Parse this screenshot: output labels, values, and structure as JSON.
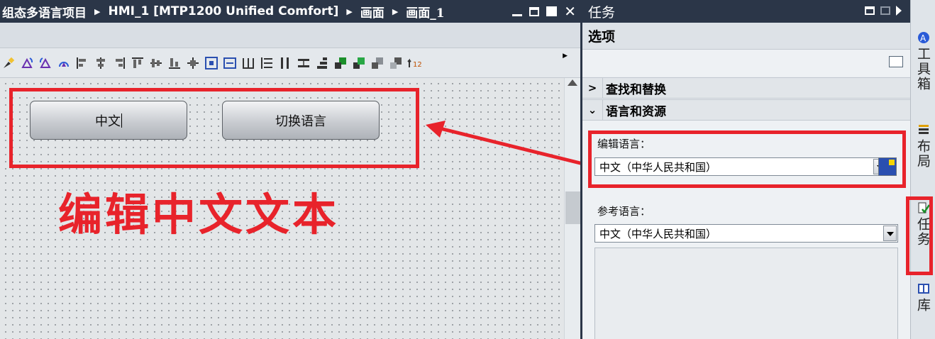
{
  "editor": {
    "breadcrumb": [
      "组态多语言项目",
      "HMI_1 [MTP1200 Unified Comfort]",
      "画面",
      "画面_1"
    ],
    "window_controls": [
      "minimize-icon",
      "restore-icon",
      "maximize-icon",
      "close-icon"
    ]
  },
  "toolbar": {
    "icons": [
      "format-brush-icon",
      "rotate-cw-icon",
      "rotate-ccw-icon",
      "flip-icon",
      "align-left-icon",
      "align-center-icon",
      "align-right-icon",
      "align-top-icon",
      "align-middle-icon",
      "align-bottom-icon",
      "center-icon",
      "same-size-icon",
      "same-width-icon",
      "distribute-h-icon",
      "distribute-v-icon",
      "same-height-icon",
      "spacing-icon",
      "stack-icon",
      "bring-front-icon",
      "bring-forward-icon",
      "send-backward-icon",
      "send-back-icon",
      "tab-order-icon"
    ]
  },
  "canvas": {
    "button1_text": "中文",
    "button2_text": "切换语言",
    "annotation_text": "编辑中文文本"
  },
  "tasks_panel": {
    "title": "任务",
    "options_header": "选项",
    "section_find": "查找和替换",
    "section_lang": "语言和资源",
    "edit_language_label": "编辑语言：",
    "edit_language_value": "中文（中华人民共和国）",
    "reference_language_label": "参考语言：",
    "reference_language_value": "中文（中华人民共和国）"
  },
  "side_tabs": [
    {
      "label": "工具箱",
      "icon": "toolbox-icon"
    },
    {
      "label": "布局",
      "icon": "layout-icon"
    },
    {
      "label": "任务",
      "icon": "tasks-icon"
    },
    {
      "label": "库",
      "icon": "library-icon"
    }
  ],
  "colors": {
    "title_bar": "#2b3648",
    "annotation_red": "#e8232b"
  }
}
